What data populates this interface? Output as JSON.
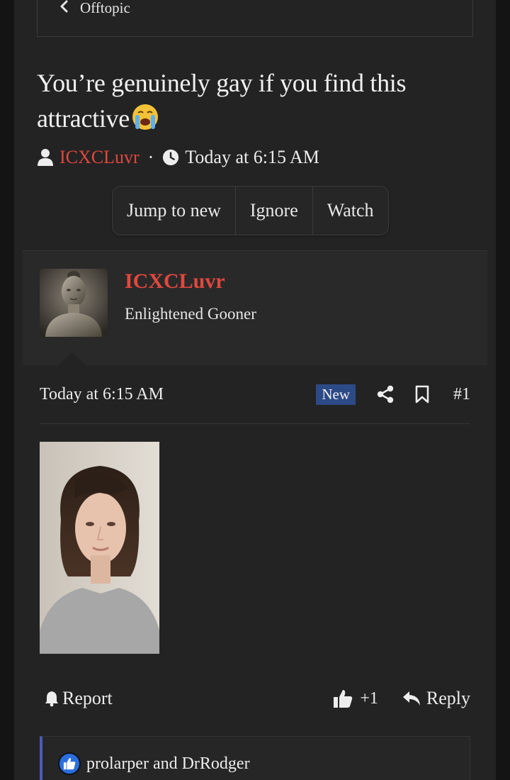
{
  "breadcrumb": {
    "label": "Offtopic"
  },
  "thread": {
    "title": "You’re genuinely gay if you find this attractive",
    "author": "ICXCLuvr",
    "separator": "·",
    "time": "Today at 6:15 AM"
  },
  "actions": {
    "jump": "Jump to new",
    "ignore": "Ignore",
    "watch": "Watch"
  },
  "user": {
    "name": "ICXCLuvr",
    "title": "Enlightened Gooner"
  },
  "post": {
    "time": "Today at 6:15 AM",
    "badge": "New",
    "number": "#1"
  },
  "footer": {
    "report": "Report",
    "like_count": "+1",
    "reply": "Reply"
  },
  "reactions": {
    "text": "prolarper and DrRodger"
  },
  "colors": {
    "author": "#e0483e",
    "badge": "#2c4a86",
    "reaction_bar": "#4d5bb8",
    "like": "#2b6fdc"
  }
}
